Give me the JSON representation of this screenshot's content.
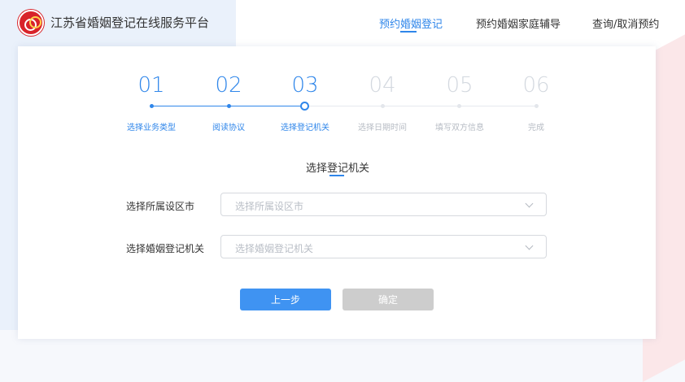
{
  "header": {
    "site_title": "江苏省婚姻登记在线服务平台",
    "nav": [
      {
        "label": "预约婚姻登记",
        "active": true
      },
      {
        "label": "预约婚姻家庭辅导",
        "active": false
      },
      {
        "label": "查询/取消预约",
        "active": false
      }
    ]
  },
  "steps": [
    {
      "num": "01",
      "label": "选择业务类型",
      "status": "done"
    },
    {
      "num": "02",
      "label": "阅读协议",
      "status": "done"
    },
    {
      "num": "03",
      "label": "选择登记机关",
      "status": "current"
    },
    {
      "num": "04",
      "label": "选择日期时间",
      "status": "todo"
    },
    {
      "num": "05",
      "label": "填写双方信息",
      "status": "todo"
    },
    {
      "num": "06",
      "label": "完成",
      "status": "todo"
    }
  ],
  "form": {
    "title": "选择登记机关",
    "fields": [
      {
        "label": "选择所属设区市",
        "placeholder": "选择所属设区市",
        "value": ""
      },
      {
        "label": "选择婚姻登记机关",
        "placeholder": "选择婚姻登记机关",
        "value": ""
      }
    ]
  },
  "buttons": {
    "prev": "上一步",
    "confirm": "确定"
  },
  "colors": {
    "accent": "#2f86ea",
    "disabled_button": "#cdcdcd",
    "brand_red": "#d8232a"
  }
}
